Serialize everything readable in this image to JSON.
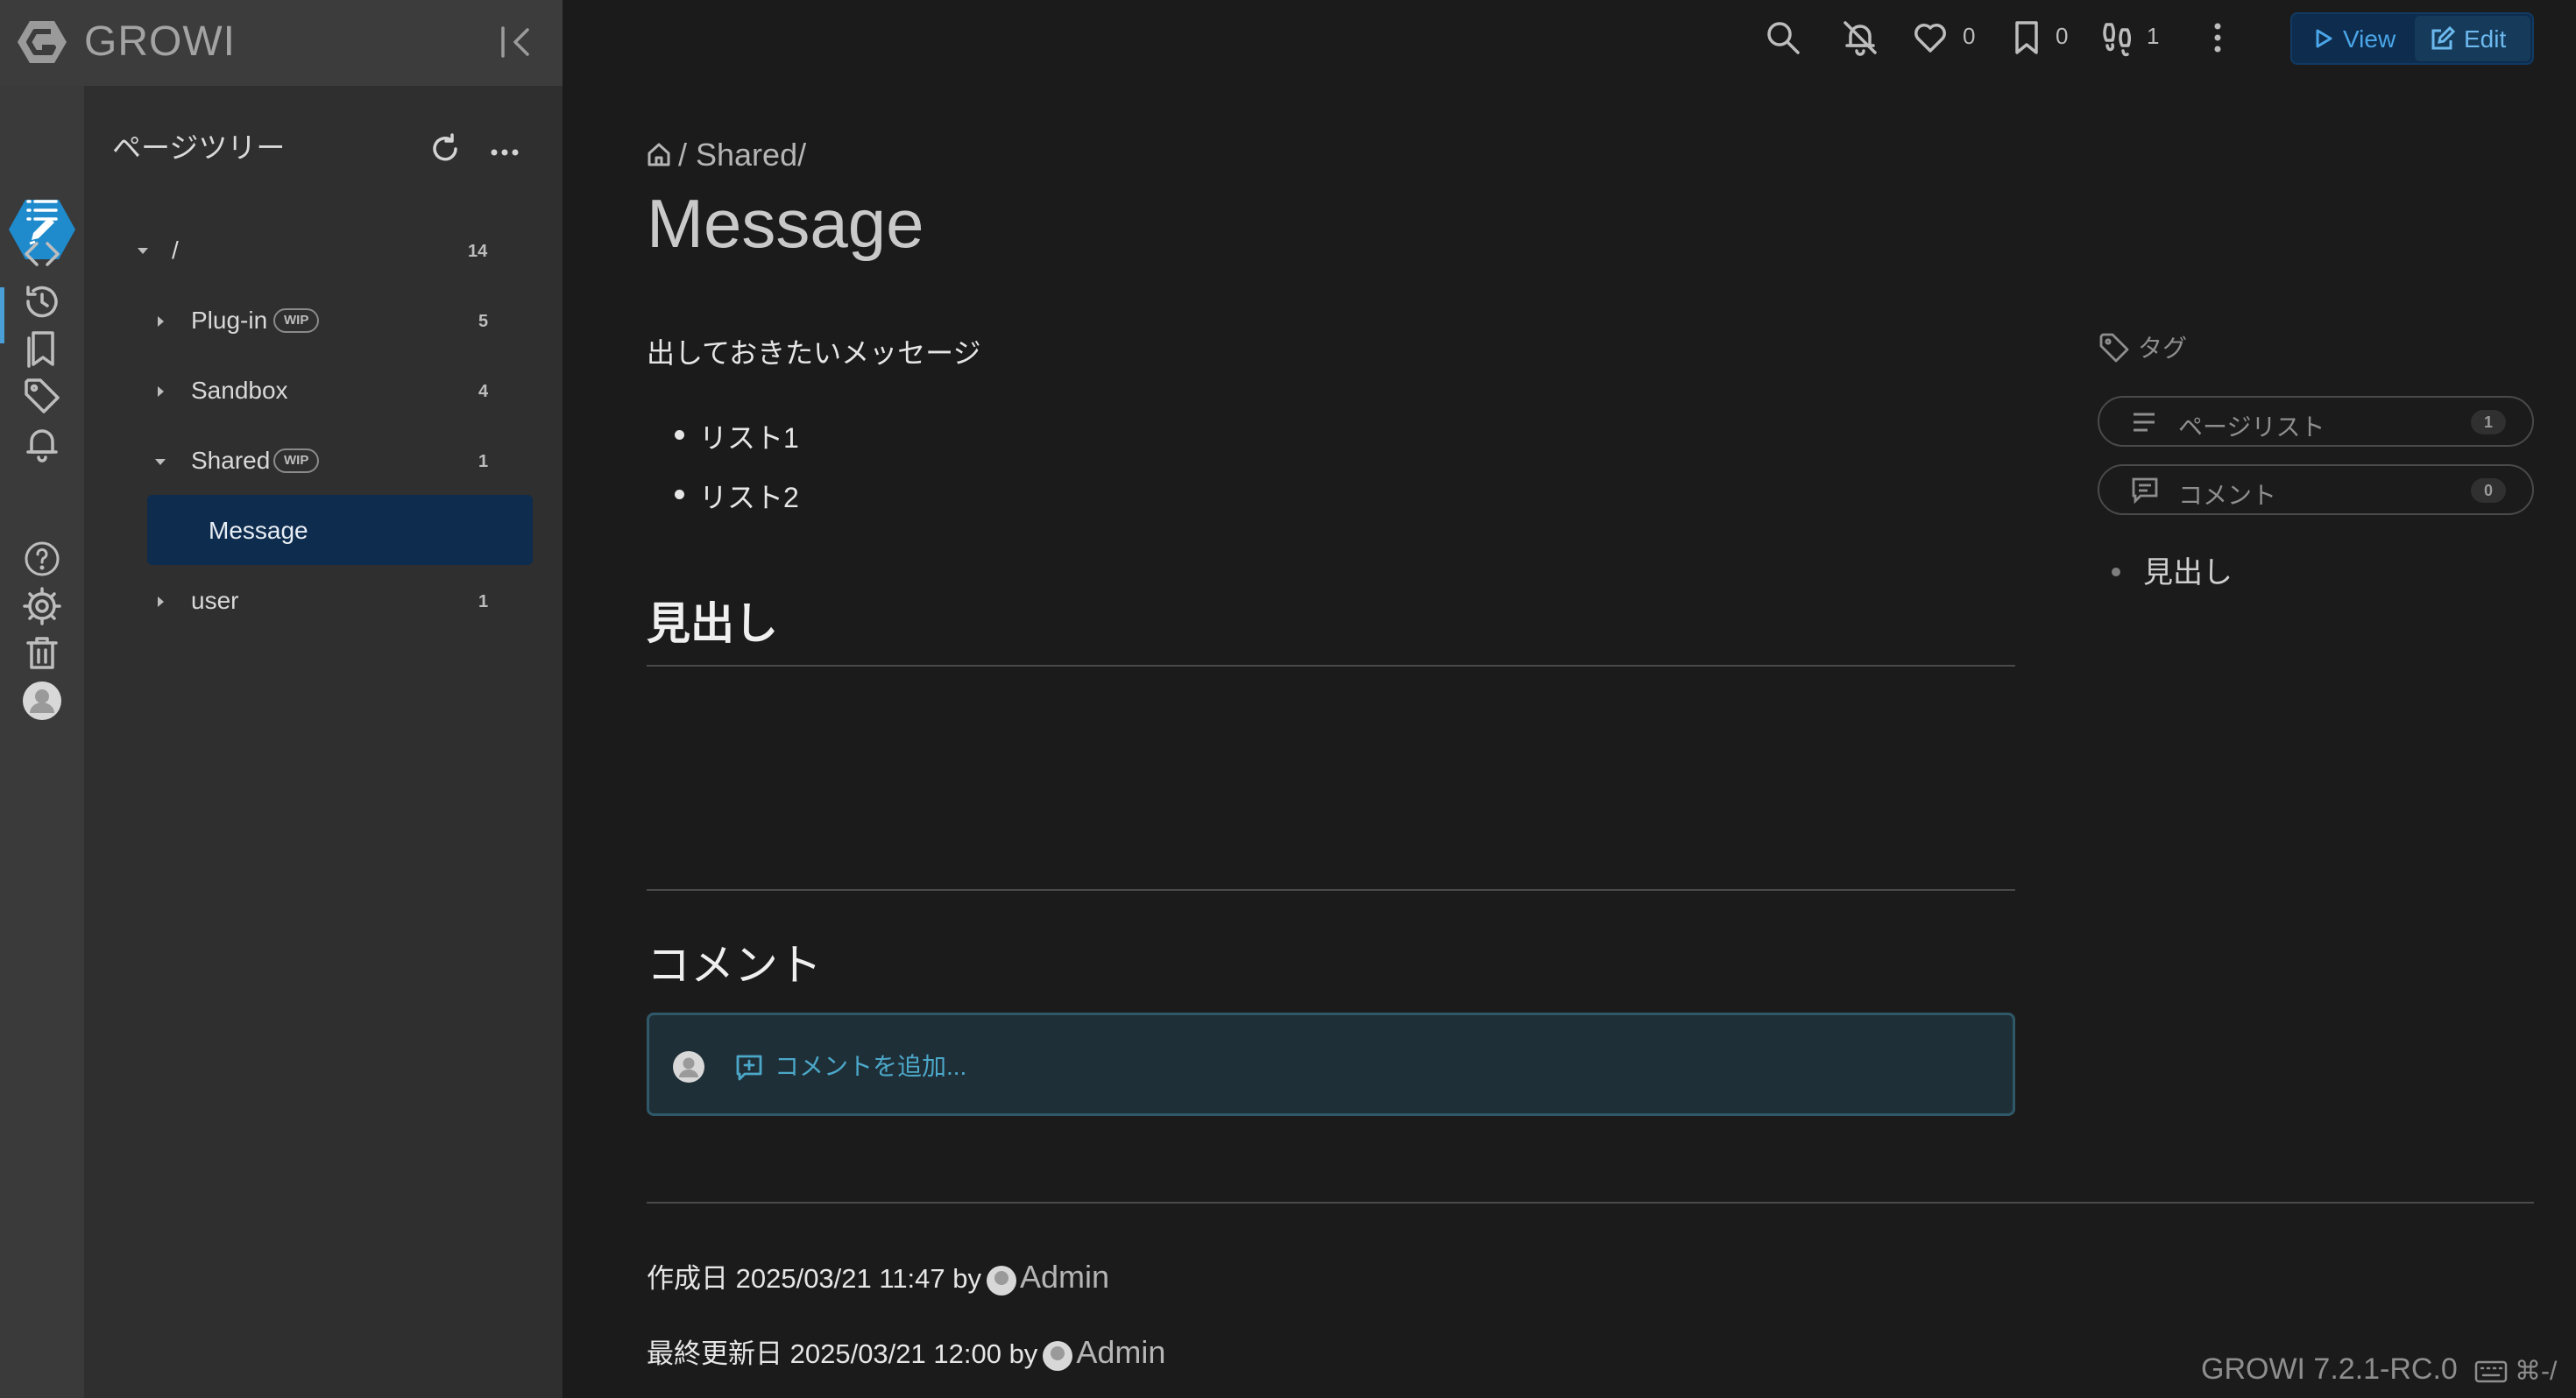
{
  "brand": {
    "name": "GROWI"
  },
  "tree": {
    "title": "ページツリー",
    "root": {
      "label": "/",
      "count": "14"
    },
    "nodes": [
      {
        "label": "Plug-in",
        "badge": "WIP",
        "count": "5"
      },
      {
        "label": "Sandbox",
        "count": "4"
      },
      {
        "label": "Shared",
        "badge": "WIP",
        "count": "1"
      },
      {
        "label": "Message"
      },
      {
        "label": "user",
        "count": "1"
      }
    ]
  },
  "toolbar": {
    "likes": "0",
    "bookmarks": "0",
    "seen": "1",
    "view_label": "View",
    "edit_label": "Edit"
  },
  "page": {
    "breadcrumb": "/ Shared/",
    "title": "Message",
    "intro": "出しておきたいメッセージ",
    "list": [
      "リスト1",
      "リスト2"
    ],
    "heading": "見出し"
  },
  "comments": {
    "heading": "コメント",
    "add_label": "コメントを追加..."
  },
  "meta": {
    "created_label": "作成日 2025/03/21 11:47 by",
    "created_author": "Admin",
    "updated_label": "最終更新日 2025/03/21 12:00 by",
    "updated_author": "Admin"
  },
  "side": {
    "tags_label": "タグ",
    "page_list_label": "ページリスト",
    "page_list_count": "1",
    "comment_label": "コメント",
    "comment_count": "0",
    "toc": [
      "見出し"
    ]
  },
  "footer": {
    "version": "GROWI 7.2.1-RC.0",
    "shortcut": "⌘-/"
  },
  "colors": {
    "accent": "#4aa0d6",
    "selected_node": "#0e2c4d",
    "comment_box": "#1f2f38",
    "background": "#1c1b1c"
  }
}
